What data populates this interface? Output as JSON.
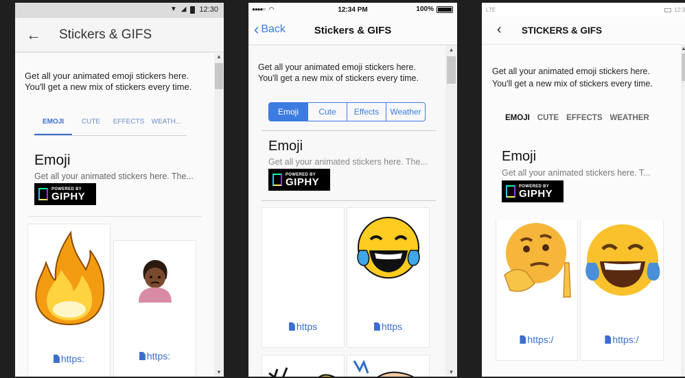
{
  "android": {
    "status_time": "12:30",
    "title": "Stickers & GIFS",
    "intro_line1": "Get all your animated emoji stickers here.",
    "intro_line2": "You'll get a new mix of stickers every time.",
    "tabs": [
      "EMOJI",
      "CUTE",
      "EFFECTS",
      "WEATH..."
    ],
    "section_title": "Emoji",
    "section_desc": "Get all your animated stickers here. The...",
    "giphy_small": "POWERED BY",
    "giphy_big": "GIPHY",
    "link_text": "https:"
  },
  "ios": {
    "carrier_dots": "●●●●○",
    "status_time": "12:34 PM",
    "battery": "100%",
    "back_label": "Back",
    "title": "Stickers & GIFS",
    "intro_line1": "Get all your animated emoji stickers here.",
    "intro_line2": "You'll get a new mix of stickers every time.",
    "segments": [
      "Emoji",
      "Cute",
      "Effects",
      "Weather"
    ],
    "section_title": "Emoji",
    "section_desc": "Get all your animated stickers here. The...",
    "giphy_small": "POWERED BY",
    "giphy_big": "GIPHY",
    "link_text": "https"
  },
  "windows": {
    "status_left": "LTE",
    "status_right": "12:3",
    "title": "STICKERS & GIFS",
    "intro_line1": "Get all your animated emoji stickers here.",
    "intro_line2": "You'll get a new mix of stickers every time.",
    "tabs": [
      "EMOJI",
      "CUTE",
      "EFFECTS",
      "WEATHER"
    ],
    "section_title": "Emoji",
    "section_desc": "Get all your animated stickers here. T...",
    "giphy_small": "POWERED BY",
    "giphy_big": "GIPHY",
    "link_text": "https:/"
  },
  "colors": {
    "accent": "#3c7be0",
    "giphy_bg": "#000000"
  }
}
